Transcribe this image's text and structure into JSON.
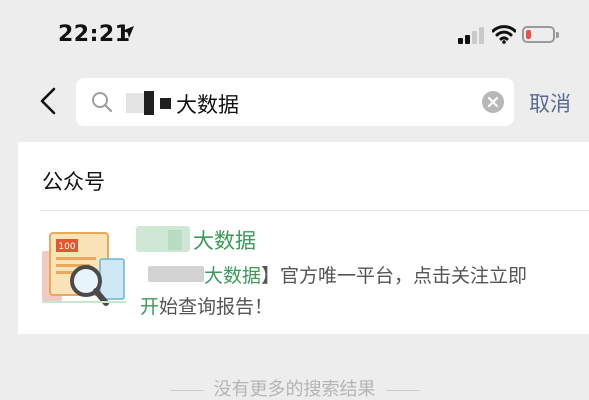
{
  "status_bar": {
    "time": "22:21",
    "battery_level": 0.2,
    "battery_color": "#e5534b",
    "icons": [
      "location-arrow-icon",
      "signal-icon",
      "wifi-icon",
      "battery-icon"
    ]
  },
  "search": {
    "query": "大数据",
    "cancel_label": "取消",
    "icons": [
      "back-chevron-icon",
      "search-icon",
      "clear-icon"
    ]
  },
  "results": {
    "section_title": "公众号",
    "account": {
      "name": "大数据",
      "desc_highlight": "大数据",
      "desc_rest": "】官方唯一平台，点击关注立即",
      "desc_line2_highlight": "开",
      "desc_line2_rest": "始查询报告！",
      "avatar_text": "100",
      "icons": [
        "report-magnifier-icon"
      ]
    }
  },
  "footer": {
    "no_more": "没有更多的搜索结果"
  },
  "colors": {
    "background": "#ededed",
    "link_blue": "#576b95",
    "highlight_green": "#3c9a5a"
  }
}
